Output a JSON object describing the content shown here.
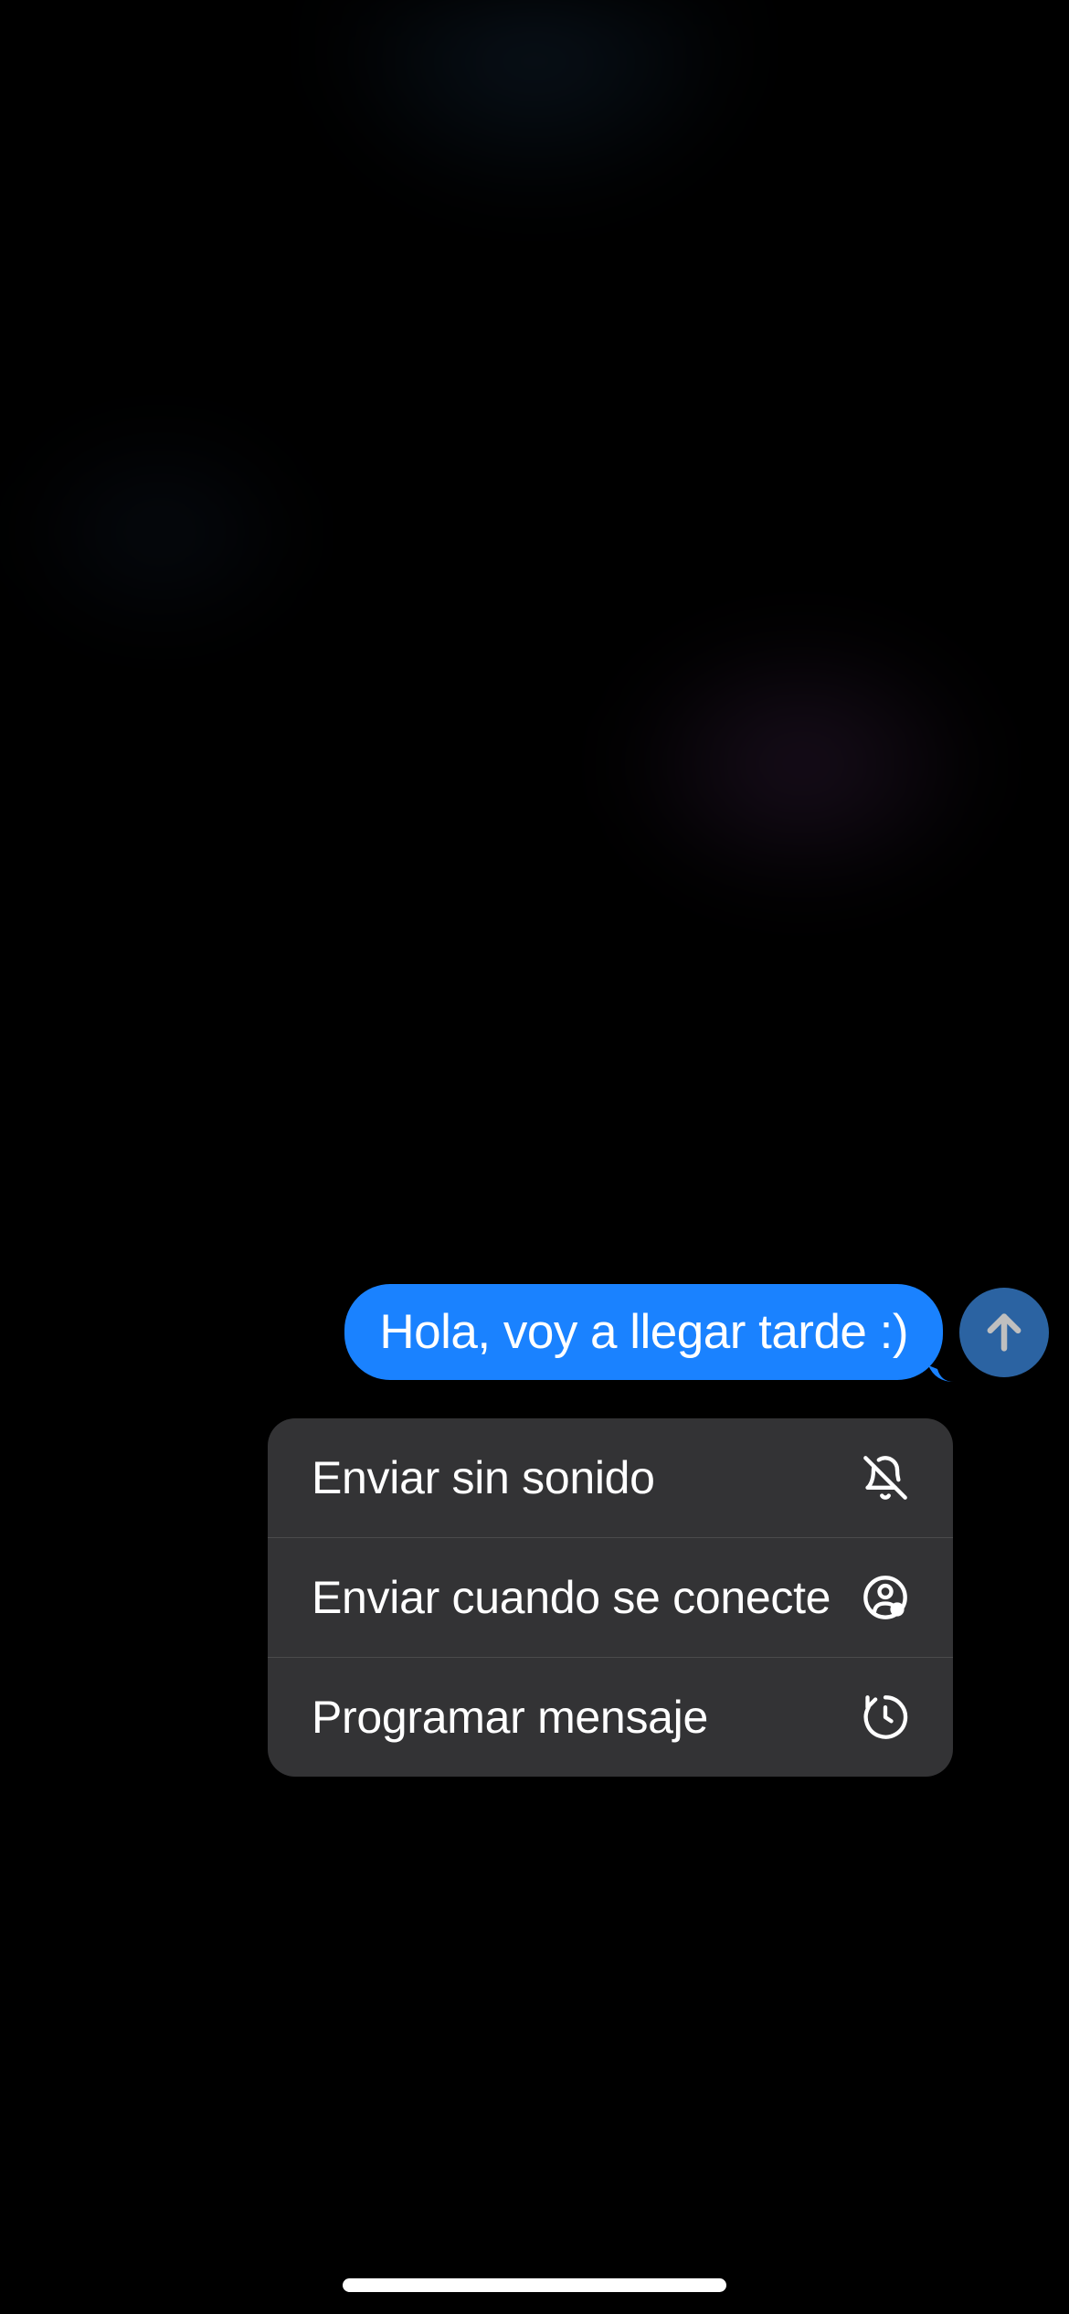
{
  "message": {
    "text": "Hola, voy a llegar tarde :)"
  },
  "sendButton": {
    "icon": "arrow-up-icon"
  },
  "contextMenu": {
    "items": [
      {
        "label": "Enviar sin sonido",
        "icon": "bell-slash-icon"
      },
      {
        "label": "Enviar cuando se conecte",
        "icon": "person-online-icon"
      },
      {
        "label": "Programar mensaje",
        "icon": "clock-rotate-icon"
      }
    ]
  }
}
